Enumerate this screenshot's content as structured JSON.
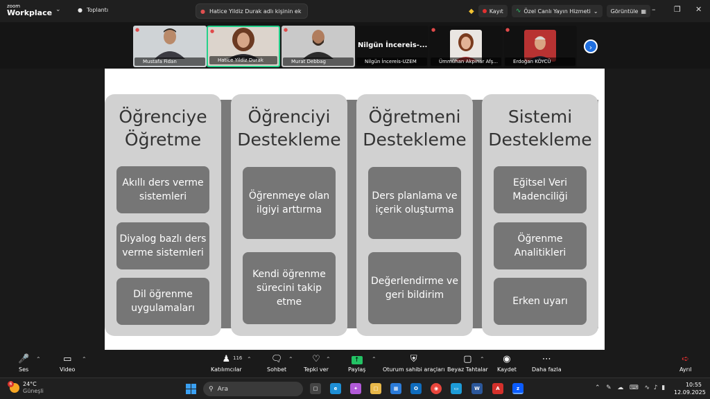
{
  "app": {
    "logo_small": "zoom",
    "logo_big": "Workplace",
    "meetings_label": "Toplantı",
    "active_speaker": "Hatice Yildiz Durak adlı kişinin ek",
    "record_label": "Kayıt",
    "stream_label": "Özel Canlı Yayın Hizmeti",
    "view_label": "Görüntüle"
  },
  "participants": [
    {
      "name": "Mustafa Fidan"
    },
    {
      "name": "Hatice Yildiz Durak"
    },
    {
      "name": "Murat Debbag"
    },
    {
      "name": "Nilgün İncereis-UZEM",
      "display": "Nilgün  İncereis-..."
    },
    {
      "name": "Ümmühan Akpınar Afş..."
    },
    {
      "name": "Erdoğan KÖYCÜ"
    }
  ],
  "slide": {
    "columns": [
      {
        "title": "Öğrenciye Öğretme",
        "title_l1": "Öğrenciye",
        "title_l2": "Öğretme",
        "items": [
          "Akıllı ders verme sistemleri",
          "Diyalog bazlı ders verme sistemleri",
          "Dil öğrenme uygulamaları"
        ]
      },
      {
        "title": "Öğrenciyi Destekleme",
        "title_l1": "Öğrenciyi",
        "title_l2": "Destekleme",
        "items": [
          "Öğrenmeye olan ilgiyi arttırma",
          "Kendi öğrenme sürecini takip etme"
        ]
      },
      {
        "title": "Öğretmeni Destekleme",
        "title_l1": "Öğretmeni",
        "title_l2": "Destekleme",
        "items": [
          "Ders planlama ve içerik oluşturma",
          "Değerlendirme ve geri bildirim"
        ]
      },
      {
        "title": "Sistemi Destekleme",
        "title_l1": "Sistemi",
        "title_l2": "Destekleme",
        "items": [
          "Eğitsel Veri Madenciliği",
          "Öğrenme Analitikleri",
          "Erken uyarı"
        ]
      }
    ]
  },
  "toolbar": {
    "audio": "Ses",
    "video": "Video",
    "participants": "Katılımcılar",
    "participants_count": "116",
    "chat": "Sohbet",
    "react": "Tepki ver",
    "share": "Paylaş",
    "host_tools": "Oturum sahibi araçları",
    "whiteboard": "Beyaz Tahtalar",
    "record": "Kaydet",
    "more": "Daha fazla",
    "leave": "Ayrıl"
  },
  "taskbar": {
    "weather_badge": "6",
    "temp": "24°C",
    "condition": "Güneşli",
    "search_placeholder": "Ara",
    "time": "10:55",
    "date": "12.09.2025"
  }
}
